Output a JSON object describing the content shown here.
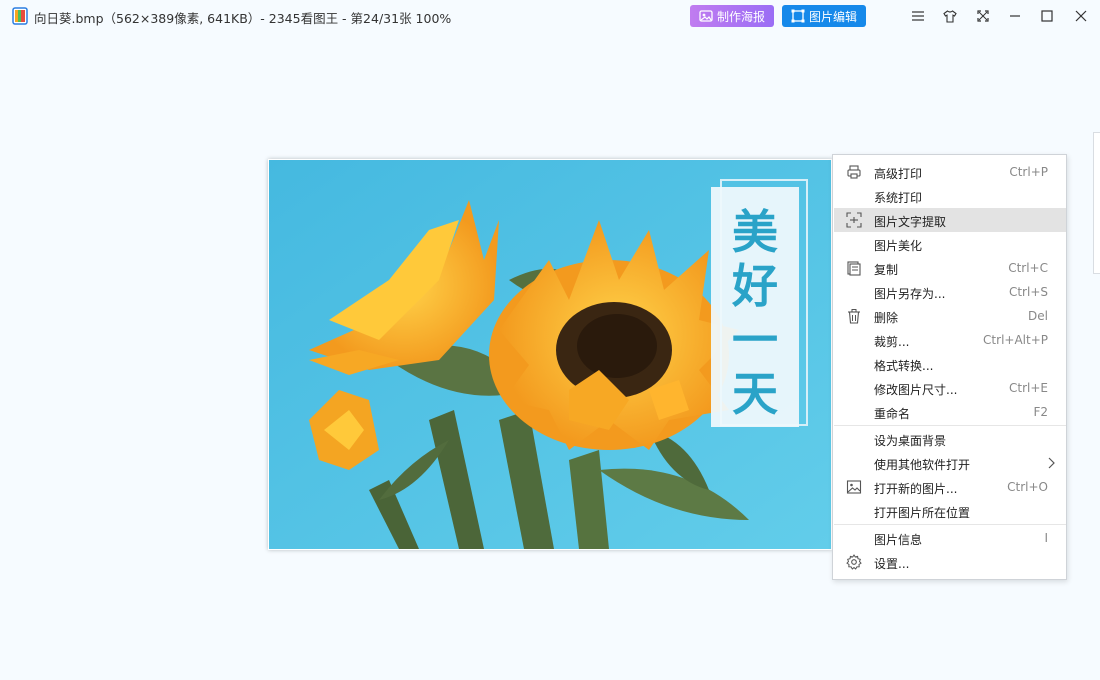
{
  "window": {
    "title": "向日葵.bmp（562×389像素, 641KB）- 2345看图王 - 第24/31张 100%",
    "poster_label": "制作海报",
    "edit_label": "图片编辑"
  },
  "image": {
    "overlay_text": [
      "美",
      "好",
      "一",
      "天"
    ]
  },
  "context_menu": [
    {
      "label": "高级打印",
      "shortcut": "Ctrl+P",
      "icon": "printer-icon"
    },
    {
      "label": "系统打印",
      "shortcut": ""
    },
    {
      "label": "图片文字提取",
      "shortcut": "",
      "icon": "text-scan-icon",
      "highlighted": true
    },
    {
      "label": "图片美化",
      "shortcut": ""
    },
    {
      "label": "复制",
      "shortcut": "Ctrl+C",
      "icon": "copy-icon"
    },
    {
      "label": "图片另存为...",
      "shortcut": "Ctrl+S"
    },
    {
      "label": "删除",
      "shortcut": "Del",
      "icon": "trash-icon"
    },
    {
      "label": "裁剪...",
      "shortcut": "Ctrl+Alt+P"
    },
    {
      "label": "格式转换...",
      "shortcut": ""
    },
    {
      "label": "修改图片尺寸...",
      "shortcut": "Ctrl+E"
    },
    {
      "label": "重命名",
      "shortcut": "F2"
    },
    {
      "label": "设为桌面背景",
      "shortcut": ""
    },
    {
      "label": "使用其他软件打开",
      "shortcut": "",
      "submenu": true
    },
    {
      "label": "打开新的图片...",
      "shortcut": "Ctrl+O",
      "icon": "image-icon"
    },
    {
      "label": "打开图片所在位置",
      "shortcut": ""
    },
    {
      "label": "图片信息",
      "shortcut": "I"
    },
    {
      "label": "设置...",
      "shortcut": "",
      "icon": "gear-icon"
    }
  ],
  "colors": {
    "background": "#f6fbff",
    "poster_button": "#a874f2",
    "edit_button": "#1689ea",
    "sky": "#4cc0e4",
    "overlay_text": "#2aa3c8",
    "petal": "#f5a623"
  }
}
